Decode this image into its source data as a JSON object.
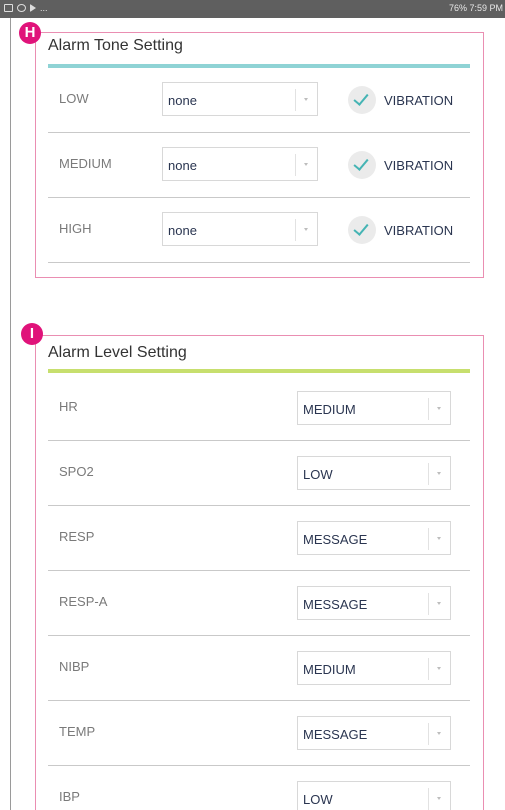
{
  "status_bar": {
    "left_icons": [
      "image-icon",
      "sync-icon",
      "play-icon"
    ],
    "left_more": "...",
    "right_text": "76% 7:59 PM"
  },
  "tone_section": {
    "badge": "H",
    "title": "Alarm Tone Setting",
    "accent_color": "#8fd3d5",
    "rows": [
      {
        "label": "LOW",
        "tone": "none",
        "vibration_label": "VIBRATION",
        "vibration_checked": true
      },
      {
        "label": "MEDIUM",
        "tone": "none",
        "vibration_label": "VIBRATION",
        "vibration_checked": true
      },
      {
        "label": "HIGH",
        "tone": "none",
        "vibration_label": "VIBRATION",
        "vibration_checked": true
      }
    ]
  },
  "level_section": {
    "badge": "I",
    "title": "Alarm Level Setting",
    "accent_color": "#c7df6e",
    "rows": [
      {
        "label": "HR",
        "level": "MEDIUM"
      },
      {
        "label": "SPO2",
        "level": "LOW"
      },
      {
        "label": "RESP",
        "level": "MESSAGE"
      },
      {
        "label": "RESP-A",
        "level": "MESSAGE"
      },
      {
        "label": "NIBP",
        "level": "MEDIUM"
      },
      {
        "label": "TEMP",
        "level": "MESSAGE"
      },
      {
        "label": "IBP",
        "level": "LOW"
      }
    ]
  },
  "colors": {
    "badge": "#e0137a",
    "section_border": "#ea8eb2",
    "check": "#45b4b4"
  }
}
